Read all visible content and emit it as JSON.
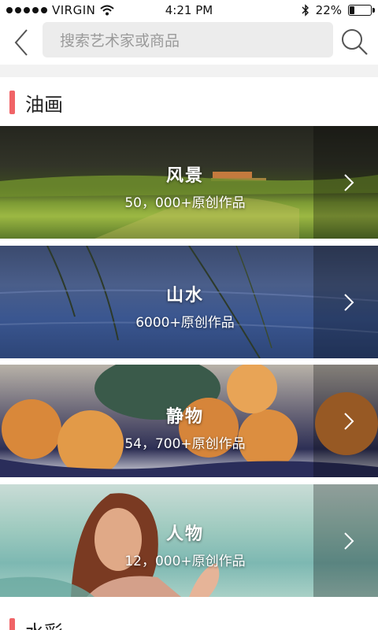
{
  "status_bar": {
    "carrier": "VIRGIN",
    "time": "4:21 PM",
    "battery_percent": "22%",
    "battery_level": 0.22
  },
  "header": {
    "back_icon": "chevron-left-icon",
    "search_placeholder": "搜索艺术家或商品",
    "search_icon": "search-icon"
  },
  "sections": [
    {
      "title": "油画",
      "categories": [
        {
          "name": "风景",
          "count": "50，000+原创作品"
        },
        {
          "name": "山水",
          "count": "6000+原创作品"
        },
        {
          "name": "静物",
          "count": "54，700+原创作品"
        },
        {
          "name": "人物",
          "count": "12，000+原创作品"
        }
      ]
    },
    {
      "title": "水彩"
    }
  ],
  "colors": {
    "accent": "#f06467",
    "search_bg": "#ececec",
    "divider": "#f2f2f2"
  }
}
